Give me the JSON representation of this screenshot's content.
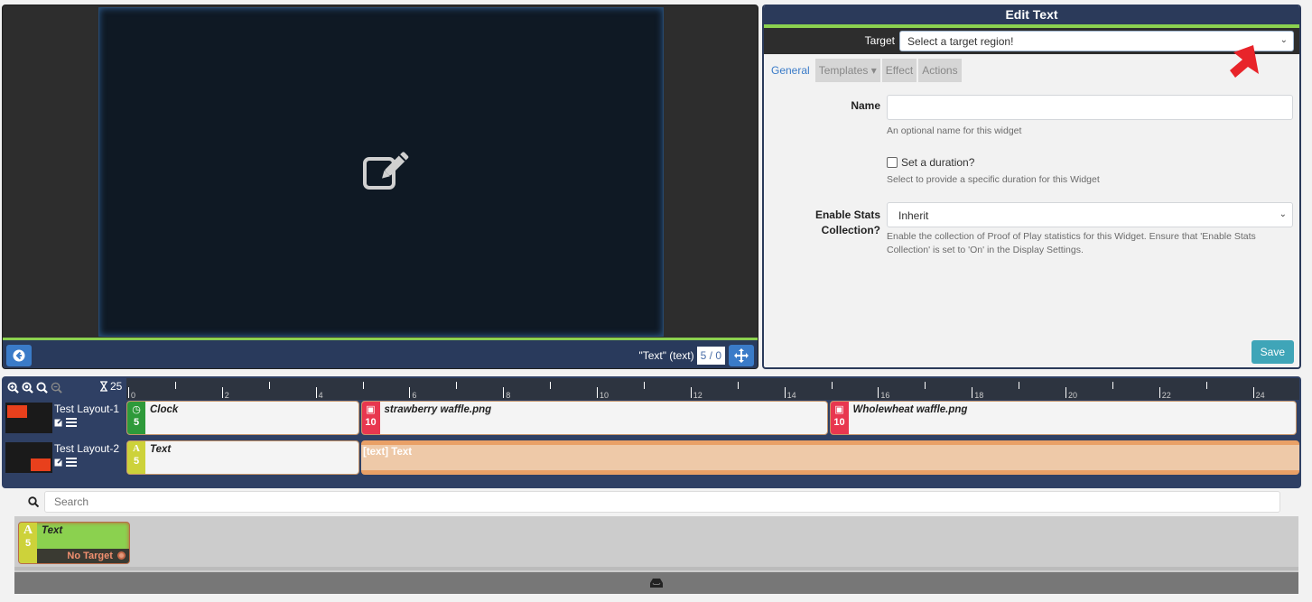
{
  "viewer": {
    "widget_label": "\"Text\" (text)",
    "duration_value": "5 / 0",
    "icons": {
      "center": "edit-icon",
      "back": "arrow-left-circle-icon",
      "move": "move-arrows-icon"
    }
  },
  "edit_panel": {
    "title": "Edit Text",
    "target_label": "Target",
    "target_value": "Select a target region!",
    "tabs": [
      {
        "label": "General",
        "active": true
      },
      {
        "label": "Templates ▾",
        "active": false
      },
      {
        "label": "Effect",
        "active": false
      },
      {
        "label": "Actions",
        "active": false
      }
    ],
    "name_label": "Name",
    "name_value": "",
    "name_help": "An optional name for this widget",
    "duration_checkbox_label": "Set a duration?",
    "duration_checked": false,
    "duration_help": "Select to provide a specific duration for this Widget",
    "stats_label_line1": "Enable Stats",
    "stats_label_line2": "Collection?",
    "stats_value": "Inherit",
    "stats_help": "Enable the collection of Proof of Play statistics for this Widget. Ensure that 'Enable Stats Collection' is set to 'On' in the Display Settings.",
    "save_label": "Save"
  },
  "timeline": {
    "duration": "25",
    "zoom_icons": [
      "zoom-in-icon",
      "zoom-fit-icon",
      "zoom-reset-icon",
      "zoom-out-icon"
    ],
    "ruler_labels": [
      "0",
      "2",
      "4",
      "6",
      "8",
      "10",
      "12",
      "14",
      "16",
      "18",
      "20",
      "22",
      "24"
    ],
    "rows": [
      {
        "name": "Test Layout-1",
        "widgets": [
          {
            "name": "Clock",
            "duration": "5",
            "icon": "clock-icon",
            "color": "#2e9a3a",
            "start": 0,
            "end": 5
          },
          {
            "name": "strawberry waffle.png",
            "duration": "10",
            "icon": "image-icon",
            "color": "#e8374f",
            "start": 5,
            "end": 15
          },
          {
            "name": "Wholewheat waffle.png",
            "duration": "10",
            "icon": "image-icon",
            "color": "#e8374f",
            "start": 15,
            "end": 25
          }
        ]
      },
      {
        "name": "Test Layout-2",
        "widgets": [
          {
            "name": "Text",
            "duration": "5",
            "icon": "font-A-icon",
            "color": "#cdd23a",
            "start": 0,
            "end": 5
          }
        ],
        "background_label": "[text] Text"
      }
    ]
  },
  "toolbox": {
    "search_placeholder": "Search",
    "card": {
      "icon": "A",
      "duration": "5",
      "title": "Text",
      "status": "No Target"
    }
  }
}
